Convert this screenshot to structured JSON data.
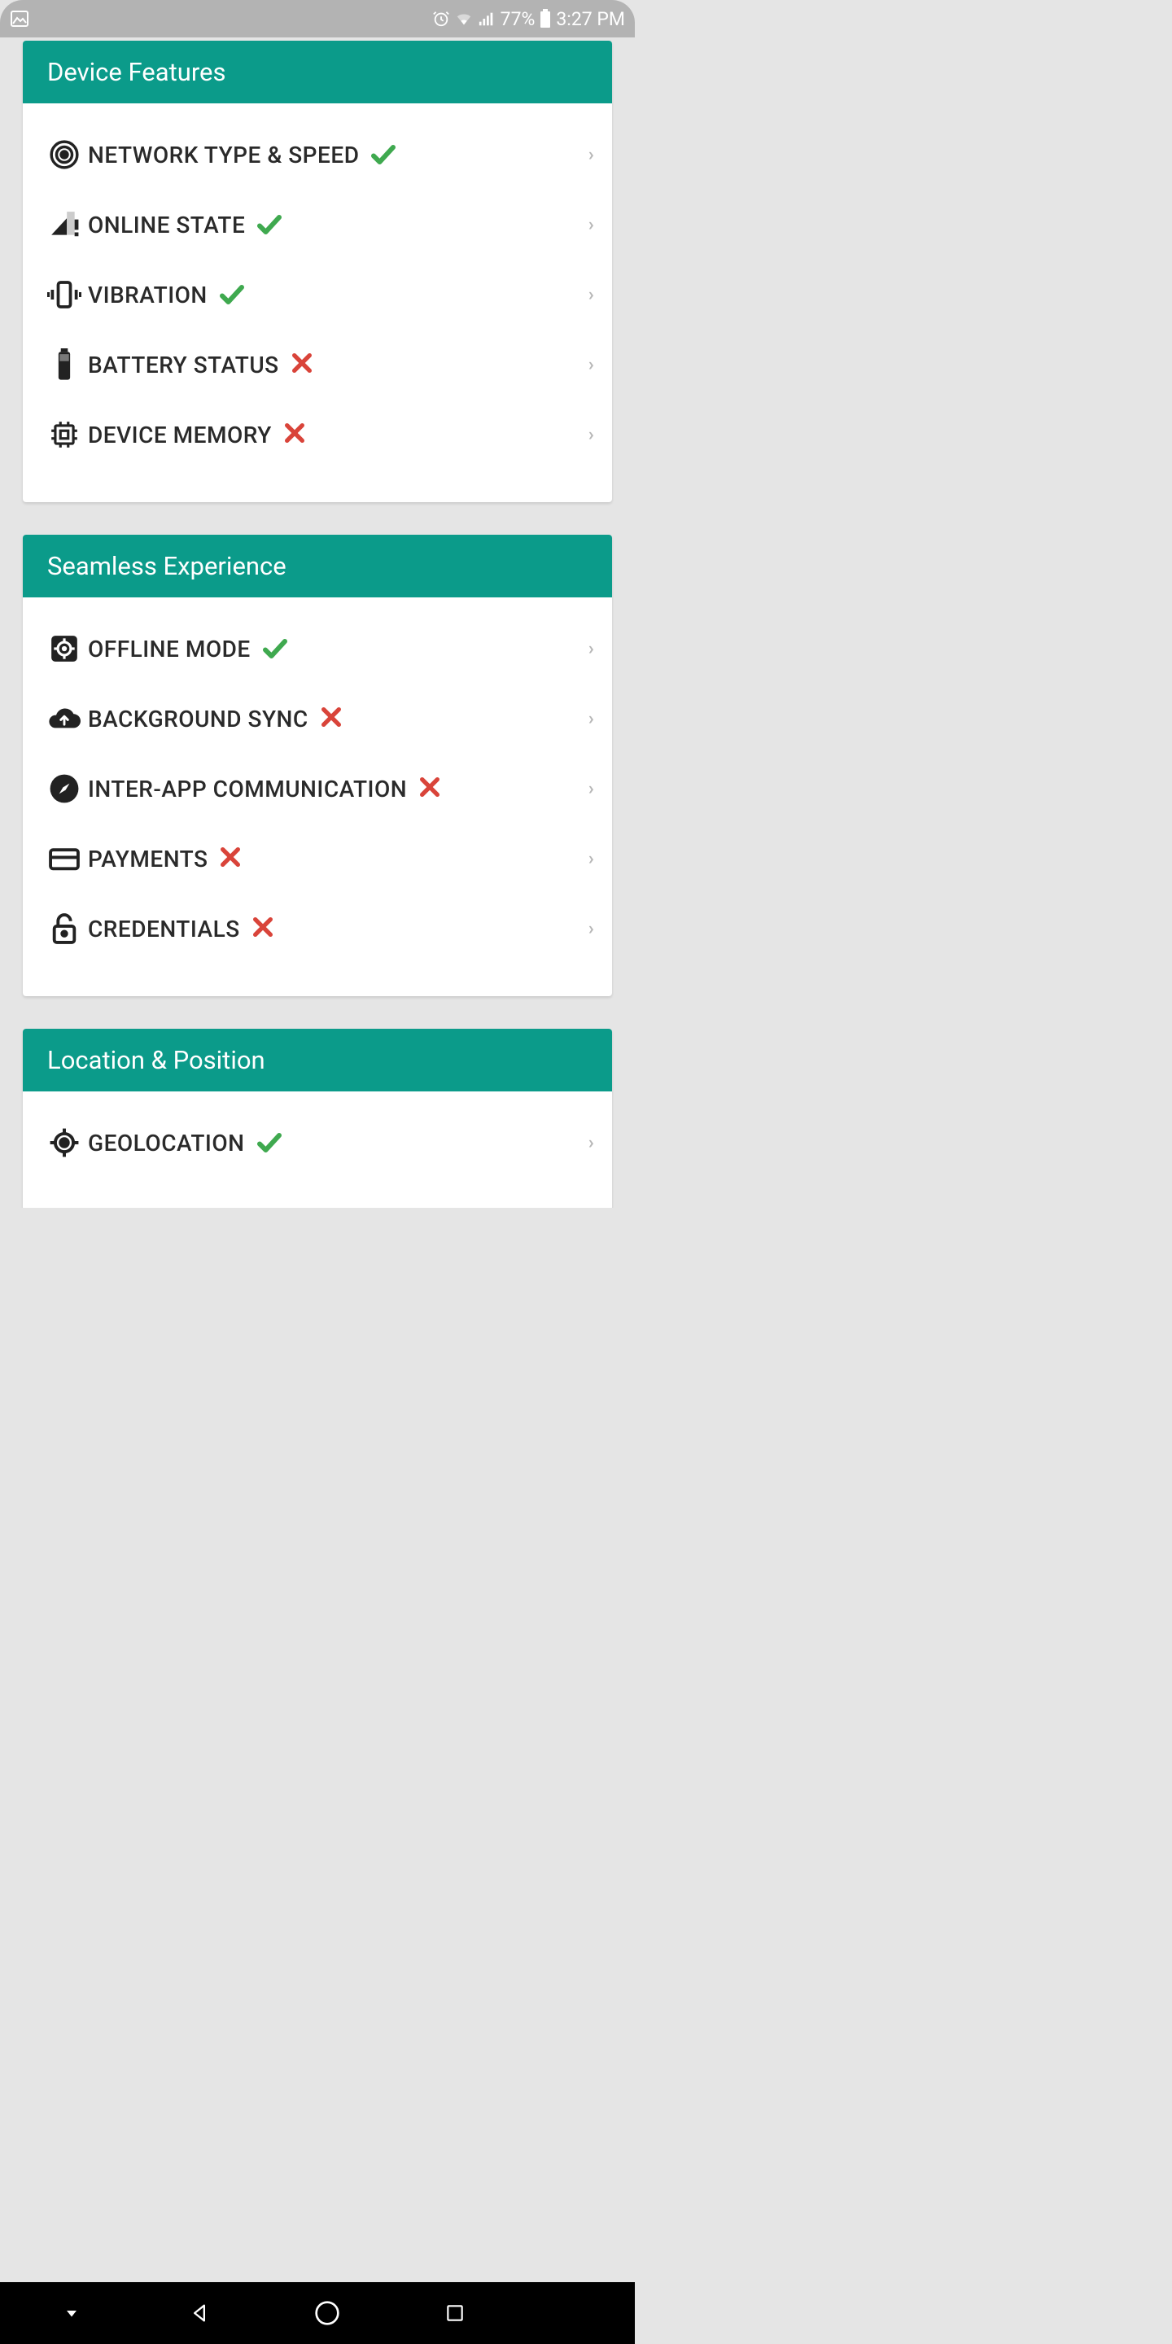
{
  "statusbar": {
    "battery_pct": "77%",
    "time": "3:27 PM"
  },
  "sections": [
    {
      "title": "Device Features",
      "items": [
        {
          "icon": "broadcast-icon",
          "label": "NETWORK TYPE & SPEED",
          "status": "ok"
        },
        {
          "icon": "signal-alert-icon",
          "label": "ONLINE STATE",
          "status": "ok"
        },
        {
          "icon": "vibration-icon",
          "label": "VIBRATION",
          "status": "ok"
        },
        {
          "icon": "battery-icon",
          "label": "BATTERY STATUS",
          "status": "fail"
        },
        {
          "icon": "chip-icon",
          "label": "DEVICE MEMORY",
          "status": "fail"
        }
      ]
    },
    {
      "title": "Seamless Experience",
      "items": [
        {
          "icon": "gear-box-icon",
          "label": "OFFLINE MODE",
          "status": "ok"
        },
        {
          "icon": "cloud-upload-icon",
          "label": "BACKGROUND SYNC",
          "status": "fail"
        },
        {
          "icon": "compass-icon",
          "label": "INTER-APP COMMUNICATION",
          "status": "fail"
        },
        {
          "icon": "card-icon",
          "label": "PAYMENTS",
          "status": "fail"
        },
        {
          "icon": "lock-open-icon",
          "label": "CREDENTIALS",
          "status": "fail"
        }
      ]
    },
    {
      "title": "Location & Position",
      "items": [
        {
          "icon": "crosshair-icon",
          "label": "GEOLOCATION",
          "status": "ok"
        }
      ]
    }
  ]
}
